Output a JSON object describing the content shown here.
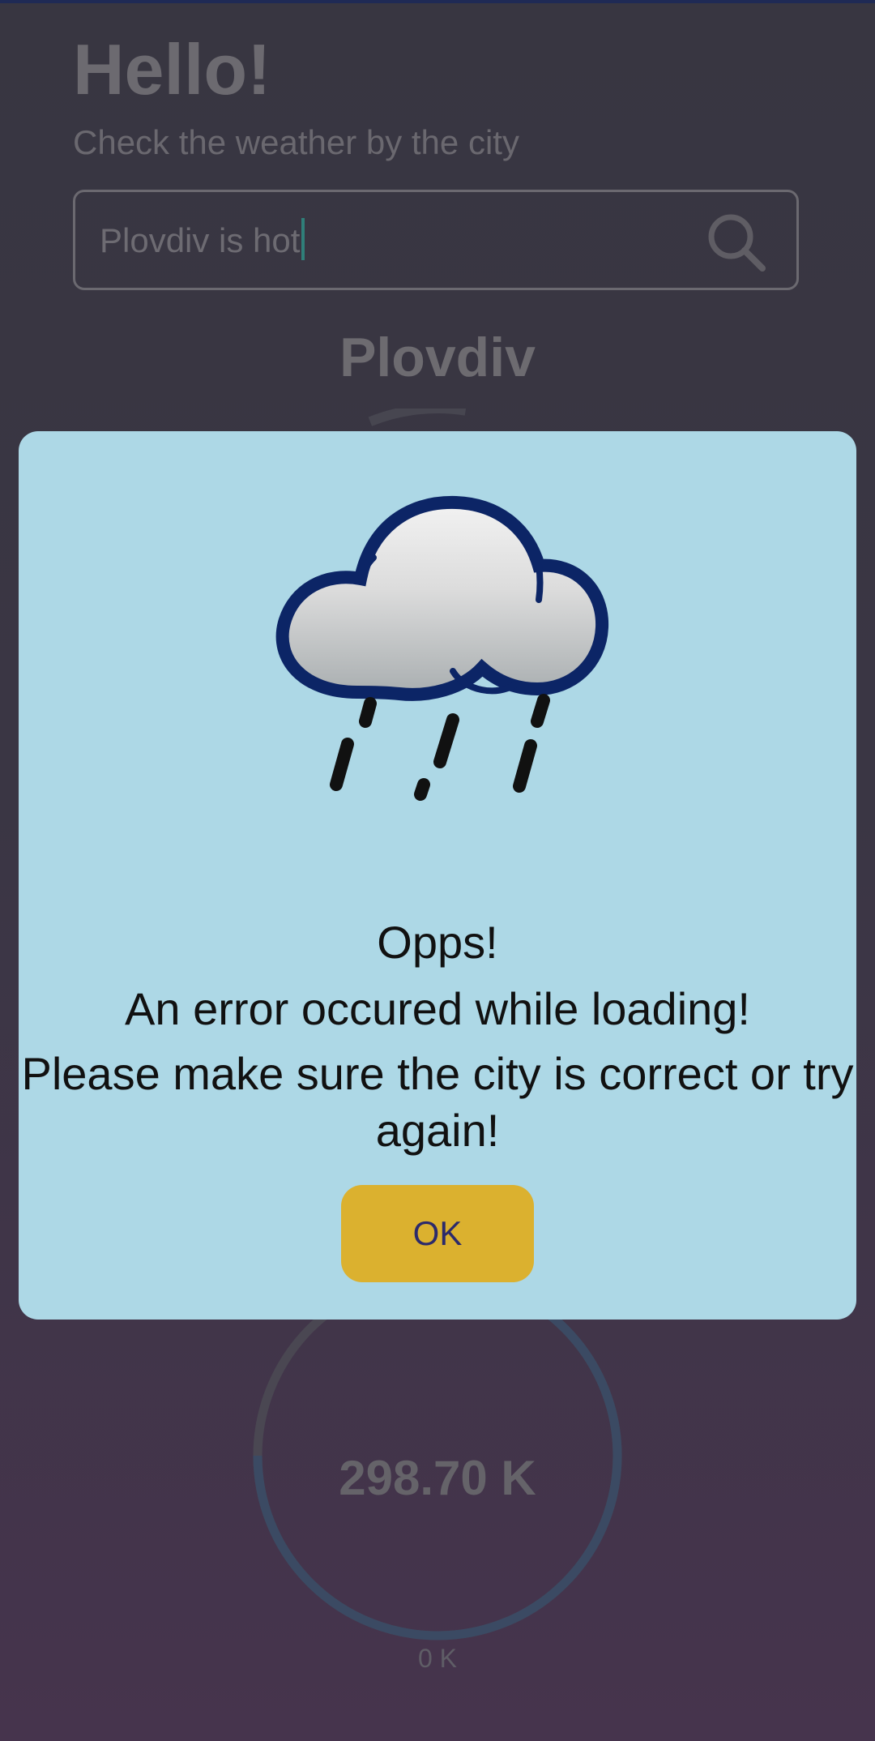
{
  "header": {
    "greeting": "Hello!",
    "subtitle": "Check the weather by the city"
  },
  "search": {
    "value": "Plovdiv is hot",
    "icon": "search-icon"
  },
  "weather": {
    "city": "Plovdiv",
    "temperature": "298.70 K",
    "gauge_min": "0 K",
    "gauge_fill_fraction": 0.75
  },
  "dialog": {
    "icon": "rain-cloud-icon",
    "title": "Opps!",
    "message_line_1": "An error occured while loading!",
    "message_line_2": "Please make sure the city is correct or try again!",
    "ok_label": "OK"
  },
  "colors": {
    "dialog_background": "#add8e6",
    "ok_button": "#dbb12f",
    "ok_text": "#2c2a6b",
    "gauge_track": "#3b4a63",
    "gauge_remainder": "#4a4752"
  }
}
